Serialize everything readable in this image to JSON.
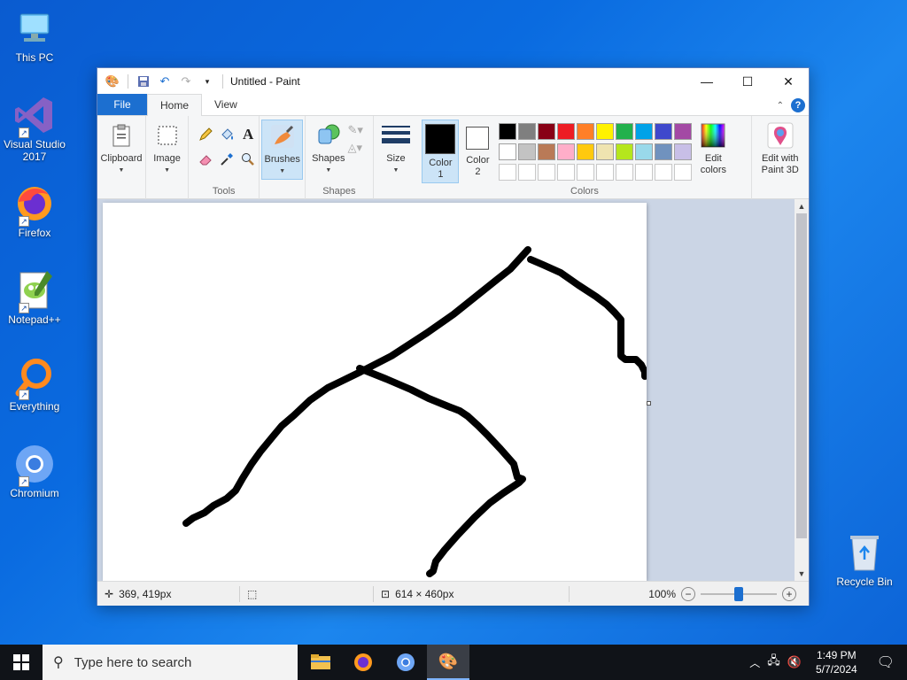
{
  "desktop": {
    "icons": [
      {
        "label": "This PC",
        "icon": "this-pc-icon"
      },
      {
        "label": "Visual Studio 2017",
        "icon": "visual-studio-icon"
      },
      {
        "label": "Firefox",
        "icon": "firefox-icon"
      },
      {
        "label": "Notepad++",
        "icon": "notepadpp-icon"
      },
      {
        "label": "Everything",
        "icon": "everything-icon"
      },
      {
        "label": "Chromium",
        "icon": "chromium-icon"
      }
    ],
    "recycle_bin": "Recycle Bin"
  },
  "window": {
    "title": "Untitled - Paint",
    "tabs": [
      "File",
      "Home",
      "View"
    ],
    "active_tab": "Home"
  },
  "ribbon": {
    "clipboard": "Clipboard",
    "image": "Image",
    "tools_label": "Tools",
    "brushes": "Brushes",
    "shapes": "Shapes",
    "shapes_group": "Shapes",
    "size": "Size",
    "color1_line1": "Color",
    "color1_line2": "1",
    "color2_line1": "Color",
    "color2_line2": "2",
    "colors_group": "Colors",
    "edit_colors_line1": "Edit",
    "edit_colors_line2": "colors",
    "paint3d_line1": "Edit with",
    "paint3d_line2": "Paint 3D",
    "color1_value": "#000000",
    "color2_value": "#ffffff",
    "palette": [
      "#000000",
      "#7f7f7f",
      "#880015",
      "#ed1c24",
      "#ff7f27",
      "#fff200",
      "#22b14c",
      "#00a2e8",
      "#3f48cc",
      "#a349a4",
      "#ffffff",
      "#c3c3c3",
      "#b97a57",
      "#ffaec9",
      "#ffc90e",
      "#efe4b0",
      "#b5e61d",
      "#99d9ea",
      "#7092be",
      "#c8bfe7",
      "#ffffff",
      "#ffffff",
      "#ffffff",
      "#ffffff",
      "#ffffff",
      "#ffffff",
      "#ffffff",
      "#ffffff",
      "#ffffff",
      "#ffffff"
    ]
  },
  "status": {
    "cursor_pos": "369, 419px",
    "canvas_size": "614 × 460px",
    "zoom": "100%",
    "zoom_level": 0.5
  },
  "taskbar": {
    "search_placeholder": "Type here to search",
    "time": "1:49 PM",
    "date": "5/7/2024"
  }
}
